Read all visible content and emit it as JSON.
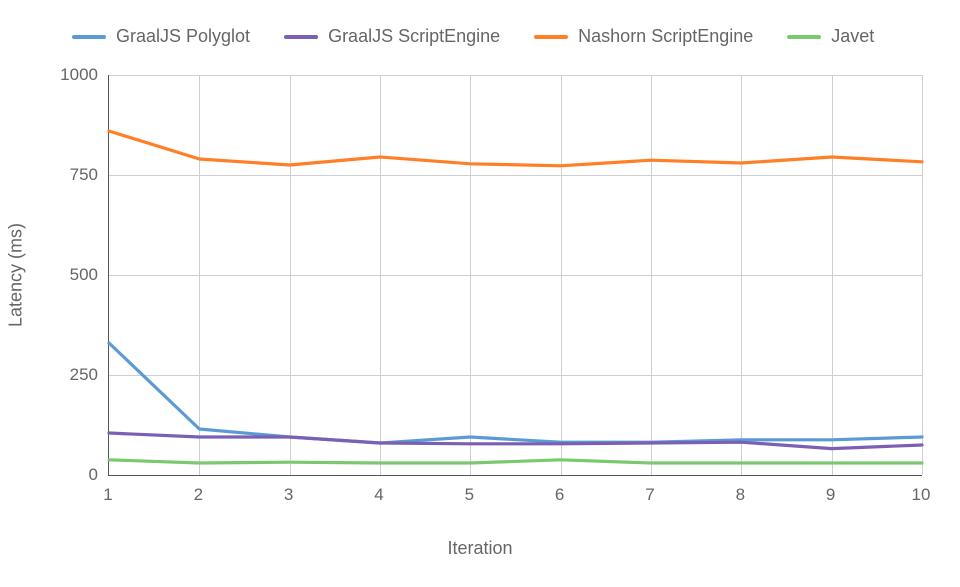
{
  "chart_data": {
    "type": "line",
    "title": "",
    "xlabel": "Iteration",
    "ylabel": "Latency (ms)",
    "xlim": [
      1,
      10
    ],
    "ylim": [
      0,
      1000
    ],
    "y_ticks": [
      0,
      250,
      500,
      750,
      1000
    ],
    "x_ticks": [
      1,
      2,
      3,
      4,
      5,
      6,
      7,
      8,
      9,
      10
    ],
    "categories": [
      1,
      2,
      3,
      4,
      5,
      6,
      7,
      8,
      9,
      10
    ],
    "grid": true,
    "legend_position": "top",
    "series": [
      {
        "name": "GraalJS Polyglot",
        "color": "#5b9bd5",
        "values": [
          330,
          115,
          95,
          80,
          95,
          82,
          82,
          88,
          88,
          95
        ]
      },
      {
        "name": "GraalJS ScriptEngine",
        "color": "#7b5fb5",
        "values": [
          105,
          95,
          95,
          80,
          78,
          78,
          80,
          82,
          66,
          75
        ]
      },
      {
        "name": "Nashorn ScriptEngine",
        "color": "#ff7f27",
        "values": [
          860,
          790,
          775,
          795,
          778,
          773,
          787,
          780,
          795,
          783
        ]
      },
      {
        "name": "Javet",
        "color": "#7bc96f",
        "values": [
          38,
          30,
          32,
          30,
          30,
          38,
          30,
          30,
          30,
          30
        ]
      }
    ]
  }
}
